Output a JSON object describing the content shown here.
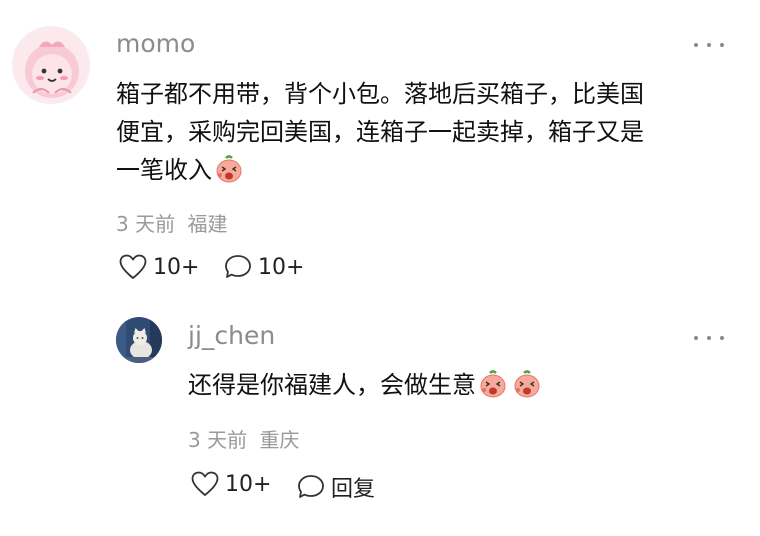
{
  "comment": {
    "avatar": "pink-cartoon-avatar",
    "username": "momo",
    "text_lines": [
      "箱子都不用带，背个小包。落地后买箱子，比美国",
      "便宜，采购完回美国，连箱子一起卖掉，箱子又是",
      "一笔收入"
    ],
    "time": "3 天前",
    "location": "福建",
    "like_count": "10+",
    "reply_count": "10+",
    "emoji": "peach-laugh-emoji"
  },
  "reply": {
    "avatar": "white-cat-avatar",
    "username": "jj_chen",
    "text": "还得是你福建人，会做生意",
    "emojis": [
      "peach-laugh-emoji",
      "peach-laugh-emoji"
    ],
    "time": "3 天前",
    "location": "重庆",
    "like_count": "10+",
    "reply_label": "回复"
  },
  "colors": {
    "meta": "#9a9a9a",
    "username": "#8c8c8c",
    "text": "#111111"
  }
}
